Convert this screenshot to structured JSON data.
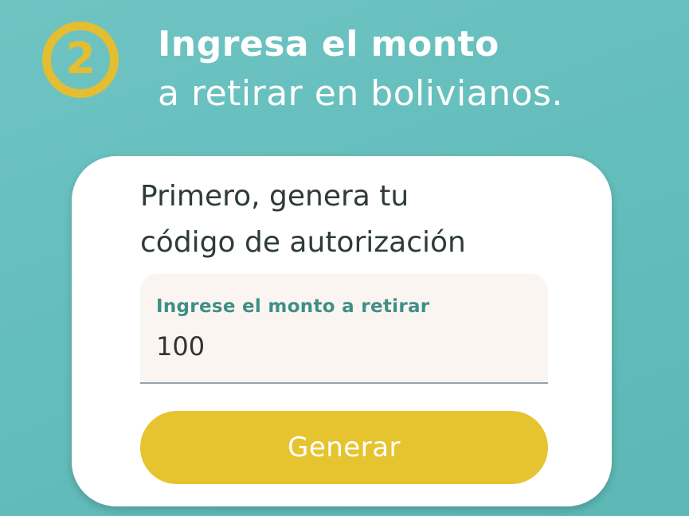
{
  "step": {
    "number": "2",
    "title_line1": "Ingresa el monto",
    "title_line2": "a retirar en bolivianos."
  },
  "card": {
    "heading_line1": "Primero, genera tu",
    "heading_line2": "código de autorización",
    "amount_field": {
      "label": "Ingrese el monto a retirar",
      "value": "100"
    },
    "generate_button": {
      "label": "Generar"
    }
  },
  "colors": {
    "background": "#62bdbb",
    "accent_yellow": "#e6c430",
    "field_label_green": "#3f8f86",
    "card_background": "#ffffff"
  }
}
